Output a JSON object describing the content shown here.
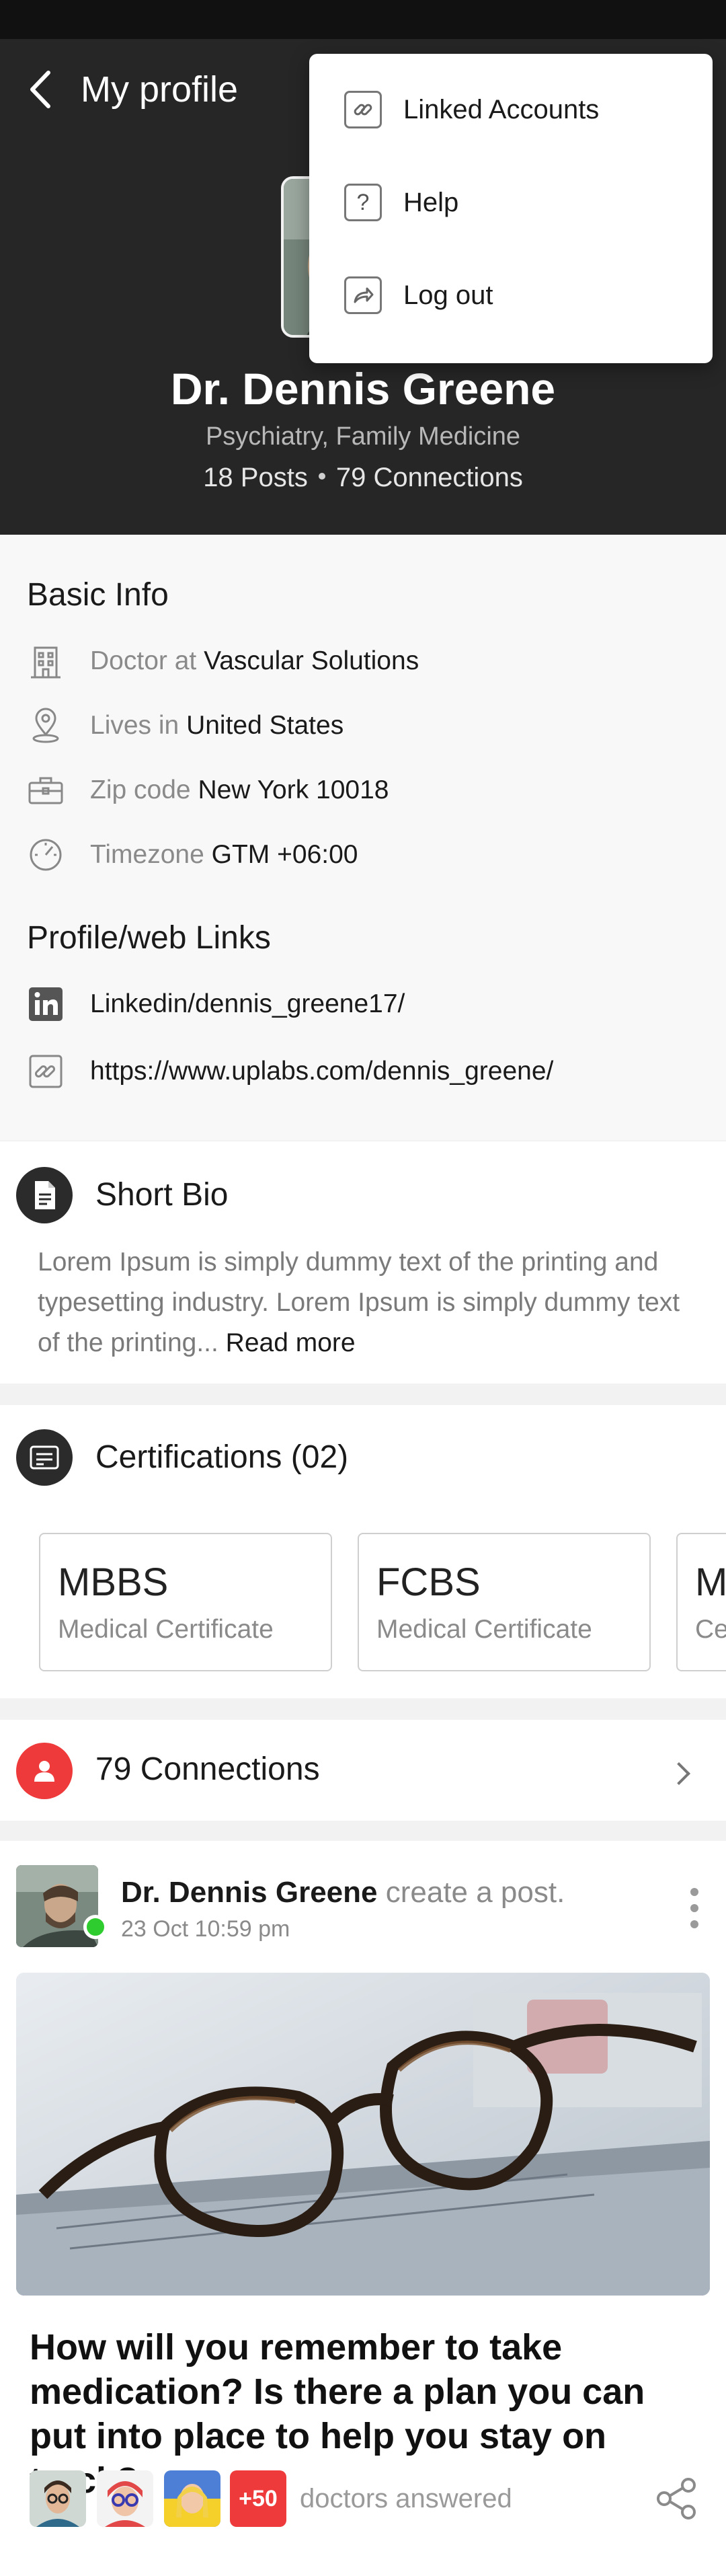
{
  "header": {
    "title": "My profile",
    "name": "Dr. Dennis Greene",
    "specialty": "Psychiatry, Family Medicine",
    "posts": "18 Posts",
    "connections": "79 Connections"
  },
  "menu": {
    "items": [
      {
        "label": "Linked Accounts",
        "icon": "link-icon"
      },
      {
        "label": "Help",
        "icon": "help-icon"
      },
      {
        "label": "Log out",
        "icon": "logout-icon"
      }
    ]
  },
  "basic_info": {
    "title": "Basic Info",
    "rows": [
      {
        "label": "Doctor at",
        "value": "Vascular Solutions",
        "icon": "building-icon"
      },
      {
        "label": "Lives in",
        "value": "United States",
        "icon": "location-pin-icon"
      },
      {
        "label": "Zip code",
        "value": "New York 10018",
        "icon": "briefcase-icon"
      },
      {
        "label": "Timezone",
        "value": "GTM +06:00",
        "icon": "gauge-icon"
      }
    ],
    "links_title": "Profile/web Links",
    "links": [
      {
        "text": "Linkedin/dennis_greene17/",
        "icon": "linkedin-icon"
      },
      {
        "text": "https://www.uplabs.com/dennis_greene/",
        "icon": "link-icon"
      }
    ]
  },
  "bio": {
    "title": "Short Bio",
    "text": "Lorem Ipsum is simply dummy text of the printing and typesetting industry. Lorem Ipsum is simply dummy text of the printing... ",
    "read_more": "Read more"
  },
  "certifications": {
    "title": "Certifications (02)",
    "items": [
      {
        "title": "MBBS",
        "subtitle": "Medical Certificate"
      },
      {
        "title": "FCBS",
        "subtitle": "Medical Certificate"
      },
      {
        "title": "M",
        "subtitle": "Ce"
      }
    ]
  },
  "connections_card": {
    "label": "79 Connections"
  },
  "post": {
    "author": "Dr. Dennis Greene",
    "action": "create a post.",
    "time": "23 Oct 10:59 pm",
    "question": "How will you remember to take medication? Is there a plan you can put into place to help you stay on track?",
    "more_count": "+50",
    "answered": "doctors answered"
  },
  "colors": {
    "header_bg": "#262626",
    "accent_red": "#ee3a3a",
    "online_green": "#2ecc2e",
    "dark_icon": "#2b2b2b"
  }
}
